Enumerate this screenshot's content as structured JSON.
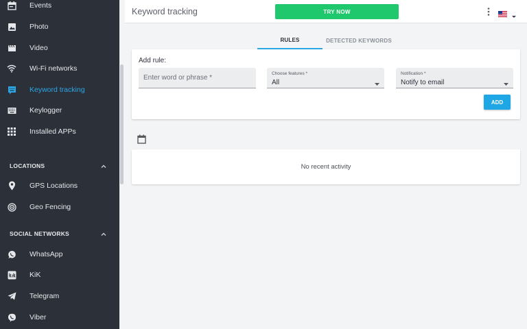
{
  "sidebar": {
    "items_top": [
      {
        "label": "Events",
        "icon": "calendar-icon"
      },
      {
        "label": "Photo",
        "icon": "photo-icon"
      },
      {
        "label": "Video",
        "icon": "video-icon"
      },
      {
        "label": "Wi-Fi networks",
        "icon": "wifi-icon"
      },
      {
        "label": "Keyword tracking",
        "icon": "keyboard-chat-icon",
        "active": true
      },
      {
        "label": "Keylogger",
        "icon": "keyboard-icon"
      },
      {
        "label": "Installed APPs",
        "icon": "apps-grid-icon"
      }
    ],
    "locations": {
      "title": "LOCATIONS",
      "items": [
        {
          "label": "GPS Locations",
          "icon": "location-pin-icon"
        },
        {
          "label": "Geo Fencing",
          "icon": "radar-icon"
        }
      ]
    },
    "social": {
      "title": "SOCIAL NETWORKS",
      "items": [
        {
          "label": "WhatsApp",
          "icon": "whatsapp-icon"
        },
        {
          "label": "KiK",
          "icon": "kik-icon"
        },
        {
          "label": "Telegram",
          "icon": "telegram-icon"
        },
        {
          "label": "Viber",
          "icon": "viber-icon"
        }
      ]
    }
  },
  "header": {
    "title": "Keyword tracking",
    "try_now": "TRY NOW"
  },
  "tabs": [
    {
      "label": "RULES",
      "active": true
    },
    {
      "label": "DETECTED KEYWORDS",
      "active": false
    }
  ],
  "rule_form": {
    "heading": "Add rule:",
    "word_placeholder": "Enter word or phrase *",
    "features_label": "Choose features *",
    "features_value": "All",
    "notification_label": "Notification *",
    "notification_value": "Notify to email",
    "add_button": "ADD"
  },
  "activity": {
    "empty_message": "No recent activity"
  },
  "colors": {
    "sidebar_bg": "#2c3038",
    "accent": "#2aa8e6",
    "try_now_green": "#1fc86c"
  }
}
